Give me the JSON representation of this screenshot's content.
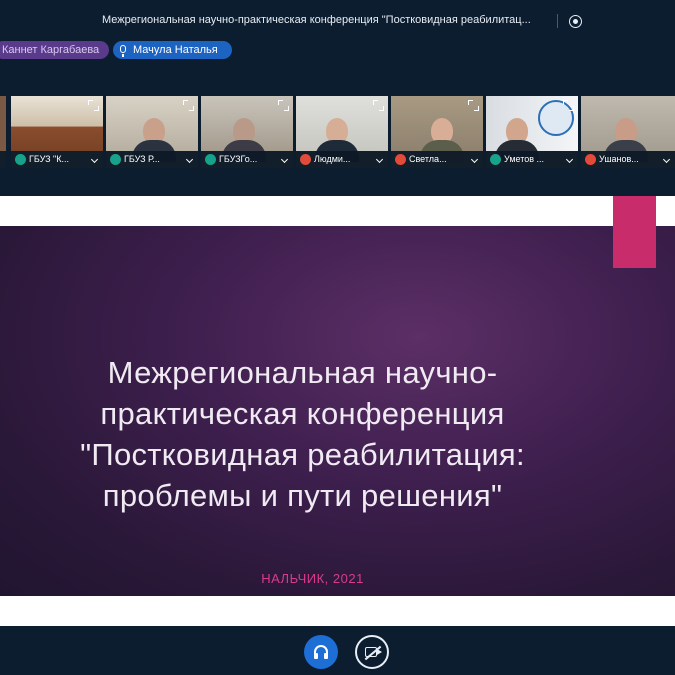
{
  "meeting": {
    "title": "Межрегиональная научно-практическая конференция \"Постковидная реабилитац..."
  },
  "talking": [
    {
      "name": "Каннет Каргабаева"
    },
    {
      "name": "Мачула Наталья"
    }
  ],
  "participants": [
    {
      "name": "ГБУЗ \"К...",
      "audio": "on"
    },
    {
      "name": "ГБУЗ Р...",
      "audio": "on"
    },
    {
      "name": "ГБУЗГо...",
      "audio": "on"
    },
    {
      "name": "Людми...",
      "audio": "off"
    },
    {
      "name": "Светла...",
      "audio": "off"
    },
    {
      "name": "Уметов ...",
      "audio": "on"
    },
    {
      "name": "Ушанов...",
      "audio": "off"
    }
  ],
  "slide": {
    "title_lines": [
      "Межрегиональная научно-",
      "практическая конференция",
      "\"Постковидная реабилитация:",
      "проблемы и пути решения\""
    ],
    "footer": "НАЛЬЧИК, 2021"
  },
  "colors": {
    "accent": "#c92c6b",
    "audio_button": "#1d6fd6",
    "status_on": "#17a38b",
    "status_off": "#e24a3a"
  },
  "icons": [
    "record-icon",
    "mic-icon",
    "expand-icon",
    "chevron-down-icon",
    "headphones-icon",
    "camera-off-icon"
  ]
}
